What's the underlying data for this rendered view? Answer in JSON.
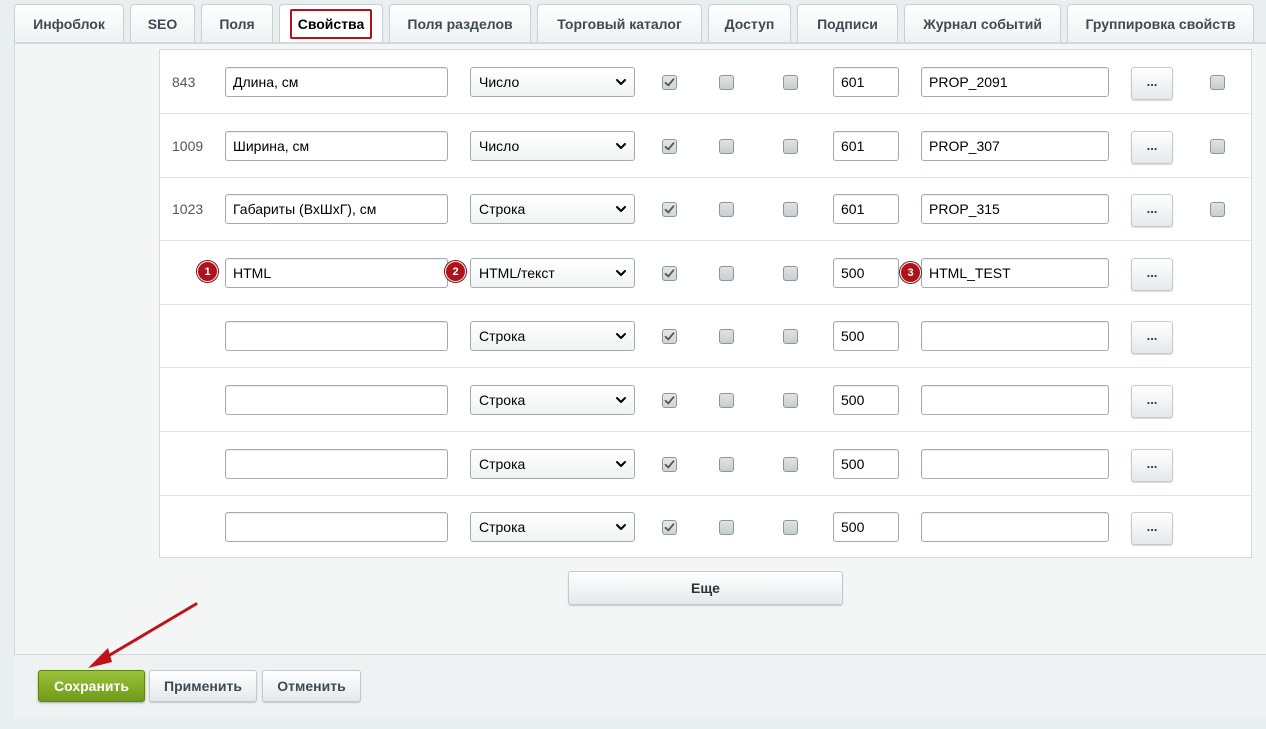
{
  "tabs": [
    {
      "label": "Инфоблок",
      "active": false
    },
    {
      "label": "SEO",
      "active": false
    },
    {
      "label": "Поля",
      "active": false
    },
    {
      "label": "Свойства",
      "active": true
    },
    {
      "label": "Поля разделов",
      "active": false
    },
    {
      "label": "Торговый каталог",
      "active": false
    },
    {
      "label": "Доступ",
      "active": false
    },
    {
      "label": "Подписи",
      "active": false
    },
    {
      "label": "Журнал событий",
      "active": false
    },
    {
      "label": "Группировка свойств",
      "active": false
    }
  ],
  "properties": {
    "rows": [
      {
        "id": "843",
        "name": "Длина, см",
        "type": "Число",
        "c1": true,
        "c2": false,
        "c3": false,
        "sort": "601",
        "code": "PROP_2091",
        "more": "...",
        "delete_cb": true
      },
      {
        "id": "1009",
        "name": "Ширина, см",
        "type": "Число",
        "c1": true,
        "c2": false,
        "c3": false,
        "sort": "601",
        "code": "PROP_307",
        "more": "...",
        "delete_cb": true
      },
      {
        "id": "1023",
        "name": "Габариты (ВхШхГ), см",
        "type": "Строка",
        "c1": true,
        "c2": false,
        "c3": false,
        "sort": "601",
        "code": "PROP_315",
        "more": "...",
        "delete_cb": true
      },
      {
        "id": "",
        "name": "HTML",
        "type": "HTML/текст",
        "c1": true,
        "c2": false,
        "c3": false,
        "sort": "500",
        "code": "HTML_TEST",
        "more": "...",
        "delete_cb": false
      },
      {
        "id": "",
        "name": "",
        "type": "Строка",
        "c1": true,
        "c2": false,
        "c3": false,
        "sort": "500",
        "code": "",
        "more": "...",
        "delete_cb": false
      },
      {
        "id": "",
        "name": "",
        "type": "Строка",
        "c1": true,
        "c2": false,
        "c3": false,
        "sort": "500",
        "code": "",
        "more": "...",
        "delete_cb": false
      },
      {
        "id": "",
        "name": "",
        "type": "Строка",
        "c1": true,
        "c2": false,
        "c3": false,
        "sort": "500",
        "code": "",
        "more": "...",
        "delete_cb": false
      },
      {
        "id": "",
        "name": "",
        "type": "Строка",
        "c1": true,
        "c2": false,
        "c3": false,
        "sort": "500",
        "code": "",
        "more": "...",
        "delete_cb": false
      }
    ]
  },
  "badges": [
    "1",
    "2",
    "3"
  ],
  "more_button": "Еще",
  "footer": {
    "save": "Сохранить",
    "apply": "Применить",
    "cancel": "Отменить"
  },
  "colors": {
    "accent_red": "#b0121a",
    "save_green": "#7aa81f"
  }
}
